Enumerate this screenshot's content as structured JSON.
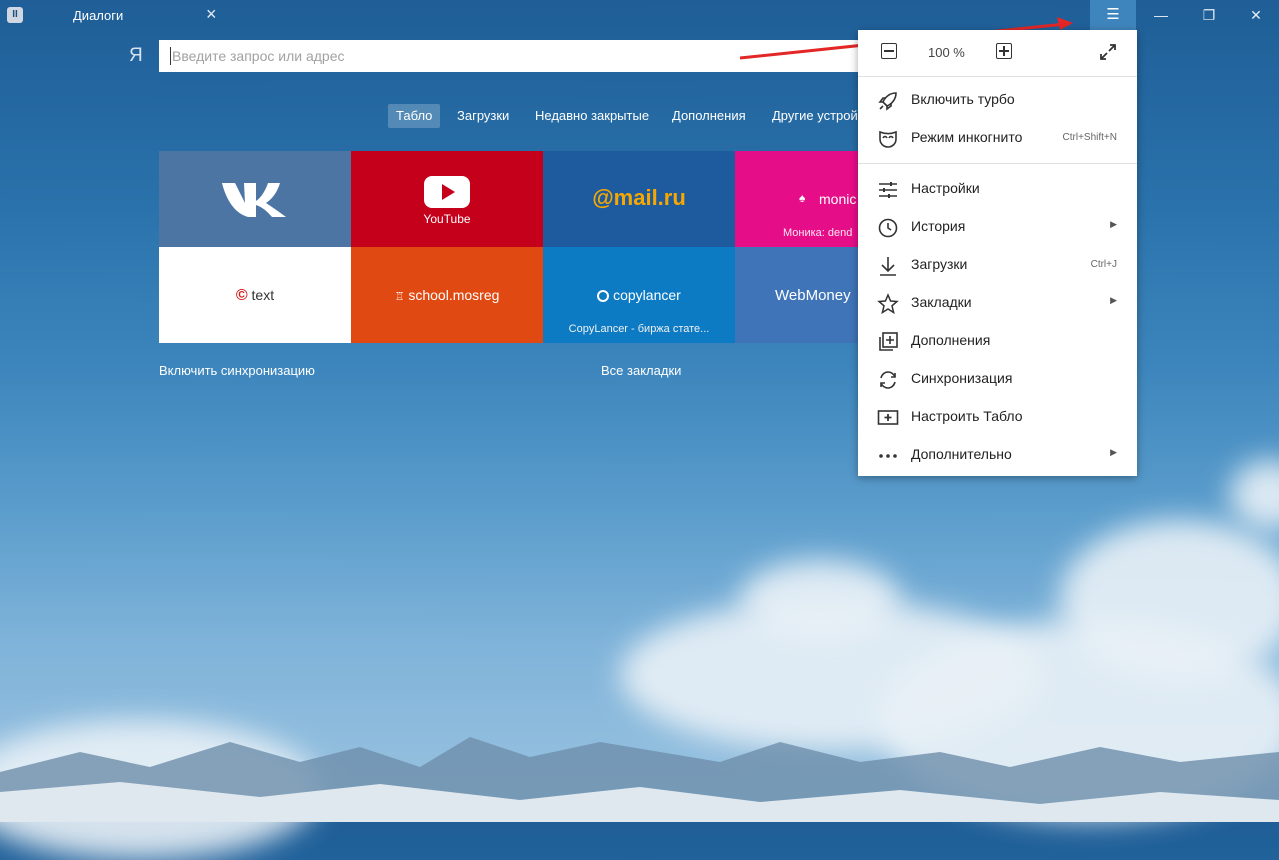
{
  "titlebar": {
    "tab_title": "Диалоги",
    "pin_icon": "pause-icon",
    "close_tab_icon": "close-icon"
  },
  "search": {
    "logo": "Я",
    "placeholder": "Введите запрос или адрес"
  },
  "nav": {
    "tabs": [
      "Табло",
      "Загрузки",
      "Недавно закрытые",
      "Дополнения",
      "Другие устрой"
    ]
  },
  "tiles": [
    {
      "name": "vk",
      "label": "",
      "caption": "",
      "color": "#4c75a3"
    },
    {
      "name": "youtube",
      "label": "YouTube",
      "caption": "",
      "color": "#c4001b"
    },
    {
      "name": "mailru",
      "label": "@mail.ru",
      "caption": "",
      "color": "#1e5a9e"
    },
    {
      "name": "monica",
      "label": "monic",
      "caption": "Моника: dend",
      "color": "#e60e88"
    },
    {
      "name": "text",
      "label": "text",
      "caption": "",
      "color": "#ffffff"
    },
    {
      "name": "school",
      "label": "school.mosreg",
      "caption": "",
      "color": "#e04912"
    },
    {
      "name": "copylancer",
      "label": "copylancer",
      "caption": "CopyLancer - биржа стате...",
      "color": "#0d7bc4"
    },
    {
      "name": "webmoney",
      "label": "WebMoney",
      "caption": "",
      "color": "#3f74b8"
    }
  ],
  "links": {
    "sync": "Включить синхронизацию",
    "bookmarks": "Все закладки"
  },
  "menu": {
    "zoom": "100 %",
    "items": [
      {
        "label": "Включить турбо",
        "icon": "rocket-icon",
        "shortcut": "",
        "submenu": false
      },
      {
        "label": "Режим инкогнито",
        "icon": "mask-icon",
        "shortcut": "Ctrl+Shift+N",
        "submenu": false
      },
      {
        "label": "Настройки",
        "icon": "sliders-icon",
        "shortcut": "",
        "submenu": false
      },
      {
        "label": "История",
        "icon": "clock-icon",
        "shortcut": "",
        "submenu": true
      },
      {
        "label": "Загрузки",
        "icon": "download-icon",
        "shortcut": "Ctrl+J",
        "submenu": false
      },
      {
        "label": "Закладки",
        "icon": "star-icon",
        "shortcut": "",
        "submenu": true
      },
      {
        "label": "Дополнения",
        "icon": "extensions-icon",
        "shortcut": "",
        "submenu": false
      },
      {
        "label": "Синхронизация",
        "icon": "sync-icon",
        "shortcut": "",
        "submenu": false
      },
      {
        "label": "Настроить Табло",
        "icon": "add-tile-icon",
        "shortcut": "",
        "submenu": false
      },
      {
        "label": "Дополнительно",
        "icon": "more-icon",
        "shortcut": "",
        "submenu": true
      }
    ]
  },
  "colors": {
    "accent_arrow": "#e32626",
    "menu_button_bg": "#3f85bd"
  }
}
